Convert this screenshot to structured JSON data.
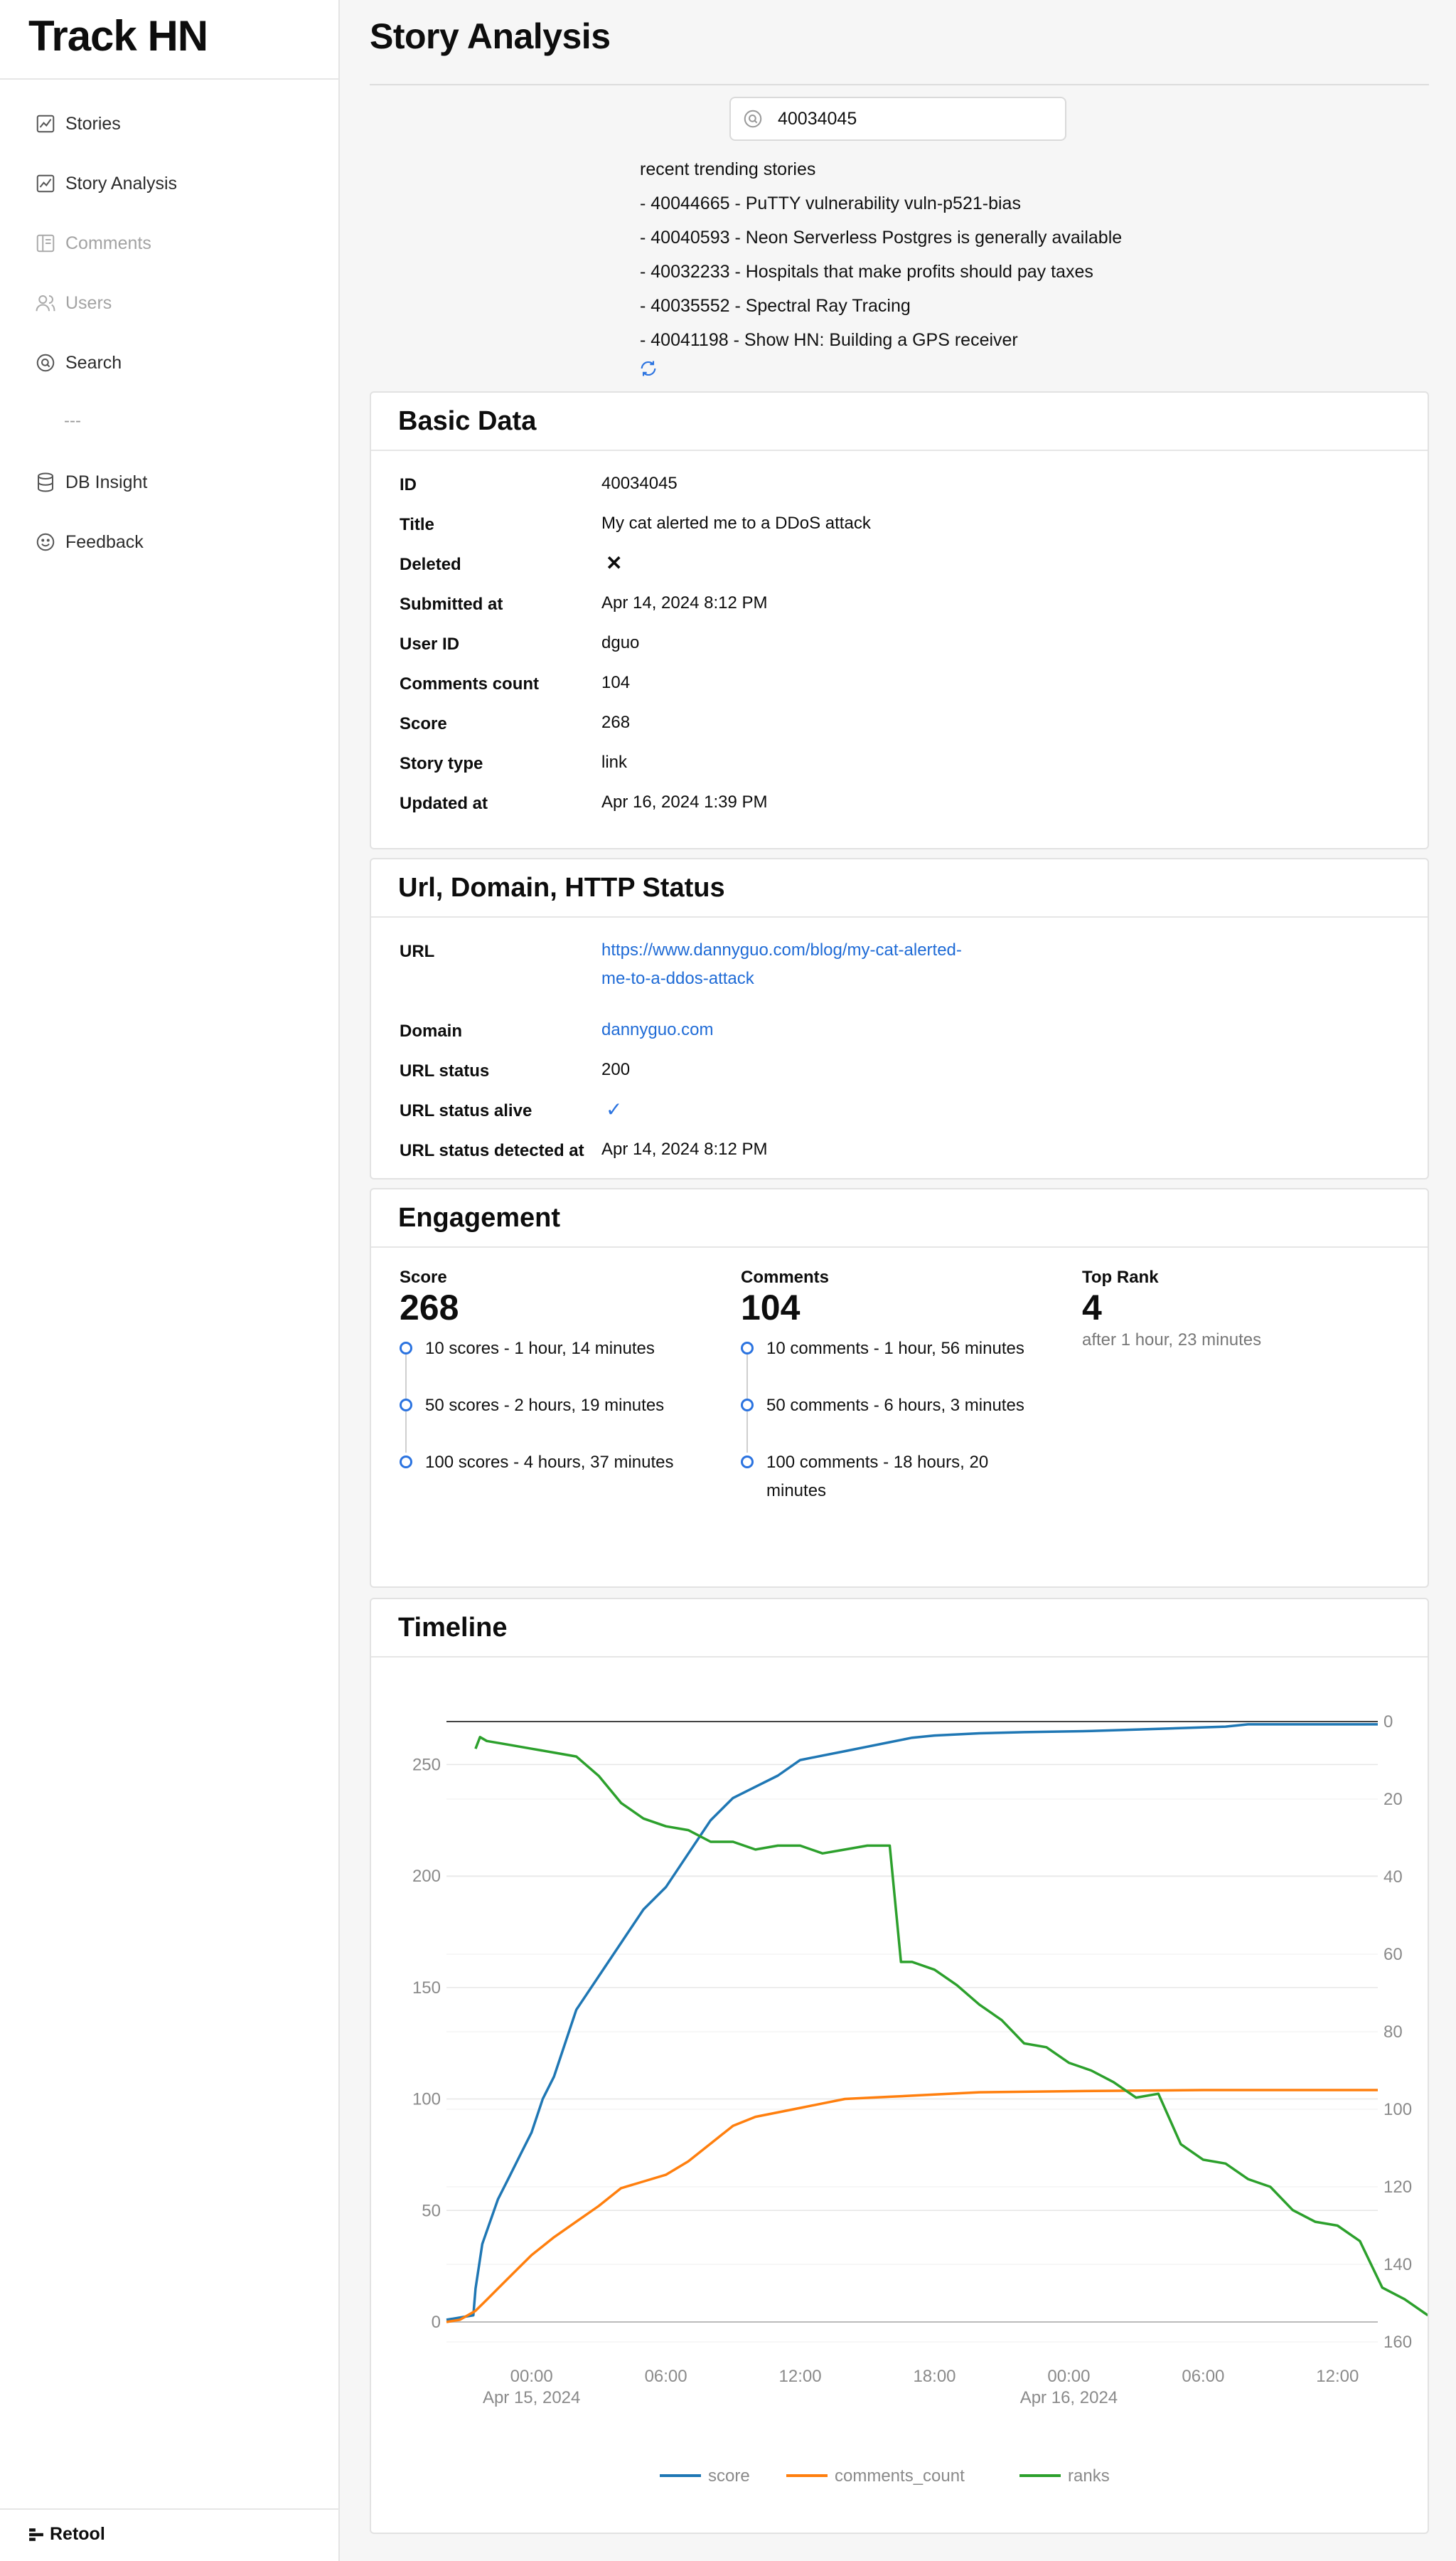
{
  "app": {
    "title": "Track HN",
    "brand": "Retool"
  },
  "sidebar": {
    "items": [
      {
        "label": "Stories",
        "icon": "chart-icon",
        "disabled": false
      },
      {
        "label": "Story Analysis",
        "icon": "chart-icon",
        "disabled": false
      },
      {
        "label": "Comments",
        "icon": "comments-icon",
        "disabled": true
      },
      {
        "label": "Users",
        "icon": "users-icon",
        "disabled": true
      },
      {
        "label": "Search",
        "icon": "search-icon",
        "disabled": false
      },
      {
        "label": "DB Insight",
        "icon": "database-icon",
        "disabled": false
      },
      {
        "label": "Feedback",
        "icon": "smile-icon",
        "disabled": false
      }
    ],
    "separator": "---"
  },
  "page": {
    "title": "Story Analysis",
    "search_value": "40034045"
  },
  "trending": {
    "heading": "recent trending stories",
    "items": [
      "- 40044665 - PuTTY vulnerability vuln-p521-bias",
      "- 40040593 - Neon Serverless Postgres is generally available",
      "- 40032233 - Hospitals that make profits should pay taxes",
      "- 40035552 - Spectral Ray Tracing",
      "- 40041198 - Show HN: Building a GPS receiver"
    ]
  },
  "basic_data": {
    "header": "Basic Data",
    "rows": [
      {
        "label": "ID",
        "value": "40034045"
      },
      {
        "label": "Title",
        "value": "My cat alerted me to a DDoS attack"
      },
      {
        "label": "Deleted",
        "value": "✕"
      },
      {
        "label": "Submitted at",
        "value": "Apr 14, 2024 8:12 PM"
      },
      {
        "label": "User ID",
        "value": "dguo"
      },
      {
        "label": "Comments count",
        "value": "104"
      },
      {
        "label": "Score",
        "value": "268"
      },
      {
        "label": "Story type",
        "value": "link"
      },
      {
        "label": "Updated at",
        "value": "Apr 16, 2024 1:39 PM"
      }
    ]
  },
  "url_card": {
    "header": "Url, Domain, HTTP Status",
    "rows": [
      {
        "label": "URL",
        "value": "https://www.dannyguo.com/blog/my-cat-alerted-me-to-a-ddos-attack",
        "link": true
      },
      {
        "label": "Domain",
        "value": "dannyguo.com",
        "link": true
      },
      {
        "label": "URL status",
        "value": "200",
        "link": false
      },
      {
        "label": "URL status alive",
        "value": "✓",
        "link": false
      },
      {
        "label": "URL status detected at",
        "value": "Apr 14, 2024 8:12 PM",
        "link": false
      }
    ]
  },
  "engagement": {
    "header": "Engagement",
    "score": {
      "label": "Score",
      "value": "268",
      "milestones": [
        "10 scores - 1 hour, 14 minutes",
        "50 scores - 2 hours, 19 minutes",
        "100 scores - 4 hours, 37 minutes"
      ]
    },
    "comments": {
      "label": "Comments",
      "value": "104",
      "milestones": [
        "10 comments - 1 hour, 56 minutes",
        "50 comments - 6 hours, 3 minutes",
        "100 comments - 18 hours, 20 minutes"
      ]
    },
    "top_rank": {
      "label": "Top Rank",
      "value": "4",
      "sub": "after 1 hour, 23 minutes"
    }
  },
  "timeline": {
    "header": "Timeline"
  },
  "colors": {
    "accent": "#2b73e0",
    "link": "#1f6bd6",
    "score": "#1f77b4",
    "comments_count": "#ff7f0e",
    "ranks": "#2ca02c"
  },
  "chart_data": {
    "type": "line",
    "x_ticks": [
      "00:00",
      "06:00",
      "12:00",
      "18:00",
      "00:00",
      "06:00",
      "12:00"
    ],
    "x_tick_sub": [
      "Apr 15, 2024",
      "",
      "",
      "",
      "Apr 16, 2024",
      "",
      ""
    ],
    "y_left_ticks": [
      0,
      50,
      100,
      150,
      200,
      250
    ],
    "y_left_range": [
      0,
      275
    ],
    "y_right_ticks": [
      0,
      20,
      40,
      60,
      80,
      100,
      120,
      140,
      160
    ],
    "y_right_range": [
      0,
      160
    ],
    "y_right_inverted": true,
    "x_range_hours": [
      -3.8,
      37.8
    ],
    "legend": [
      "score",
      "comments_count",
      "ranks"
    ],
    "legend_position": "bottom",
    "series": [
      {
        "name": "score",
        "axis": "left",
        "points": [
          [
            -3.8,
            1
          ],
          [
            -2.6,
            3
          ],
          [
            -2.5,
            15
          ],
          [
            -2.2,
            35
          ],
          [
            -1.5,
            55
          ],
          [
            -1,
            65
          ],
          [
            -0.5,
            75
          ],
          [
            0,
            85
          ],
          [
            0.5,
            100
          ],
          [
            1,
            110
          ],
          [
            1.5,
            125
          ],
          [
            2,
            140
          ],
          [
            3,
            155
          ],
          [
            4,
            170
          ],
          [
            5,
            185
          ],
          [
            6,
            195
          ],
          [
            7,
            210
          ],
          [
            8,
            225
          ],
          [
            9,
            235
          ],
          [
            10,
            240
          ],
          [
            11,
            245
          ],
          [
            12,
            252
          ],
          [
            13,
            254
          ],
          [
            14,
            256
          ],
          [
            15,
            258
          ],
          [
            16,
            260
          ],
          [
            17,
            262
          ],
          [
            18,
            263
          ],
          [
            20,
            264
          ],
          [
            22,
            264.5
          ],
          [
            25,
            265
          ],
          [
            28,
            266
          ],
          [
            31,
            267
          ],
          [
            32,
            268
          ],
          [
            37.8,
            268
          ]
        ]
      },
      {
        "name": "comments_count",
        "axis": "left",
        "points": [
          [
            -3.8,
            0
          ],
          [
            -3.2,
            1
          ],
          [
            -2.5,
            5
          ],
          [
            -2,
            10
          ],
          [
            -1.5,
            15
          ],
          [
            -1,
            20
          ],
          [
            -0.5,
            25
          ],
          [
            0,
            30
          ],
          [
            1,
            38
          ],
          [
            2,
            45
          ],
          [
            3,
            52
          ],
          [
            4,
            60
          ],
          [
            5,
            63
          ],
          [
            6,
            66
          ],
          [
            7,
            72
          ],
          [
            8,
            80
          ],
          [
            9,
            88
          ],
          [
            10,
            92
          ],
          [
            11,
            94
          ],
          [
            12,
            96
          ],
          [
            13,
            98
          ],
          [
            14,
            100
          ],
          [
            16,
            101
          ],
          [
            18,
            102
          ],
          [
            20,
            103
          ],
          [
            24,
            103.5
          ],
          [
            30,
            104
          ],
          [
            37.8,
            104
          ]
        ]
      },
      {
        "name": "ranks",
        "axis": "right",
        "points": [
          [
            -2.5,
            7
          ],
          [
            -2.3,
            4
          ],
          [
            -2,
            5
          ],
          [
            -1,
            6
          ],
          [
            0,
            7
          ],
          [
            1,
            8
          ],
          [
            2,
            9
          ],
          [
            3,
            14
          ],
          [
            4,
            21
          ],
          [
            5,
            25
          ],
          [
            6,
            27
          ],
          [
            7,
            28
          ],
          [
            8,
            31
          ],
          [
            9,
            31
          ],
          [
            10,
            33
          ],
          [
            11,
            32
          ],
          [
            12,
            32
          ],
          [
            13,
            34
          ],
          [
            14,
            33
          ],
          [
            15,
            32
          ],
          [
            16,
            32
          ],
          [
            16.5,
            62
          ],
          [
            17,
            62
          ],
          [
            18,
            64
          ],
          [
            19,
            68
          ],
          [
            20,
            73
          ],
          [
            21,
            77
          ],
          [
            22,
            83
          ],
          [
            23,
            84
          ],
          [
            24,
            88
          ],
          [
            25,
            90
          ],
          [
            26,
            93
          ],
          [
            27,
            97
          ],
          [
            28,
            96
          ],
          [
            29,
            109
          ],
          [
            30,
            113
          ],
          [
            31,
            114
          ],
          [
            32,
            118
          ],
          [
            33,
            120
          ],
          [
            34,
            126
          ],
          [
            35,
            129
          ],
          [
            36,
            130
          ],
          [
            37,
            134
          ],
          [
            38,
            146
          ],
          [
            39,
            149
          ],
          [
            40,
            153
          ],
          [
            41,
            155
          ],
          [
            42,
            154
          ],
          [
            43,
            152
          ],
          [
            44,
            151
          ],
          [
            45,
            155
          ],
          [
            46,
            157
          ],
          [
            47,
            158
          ]
        ]
      }
    ]
  }
}
